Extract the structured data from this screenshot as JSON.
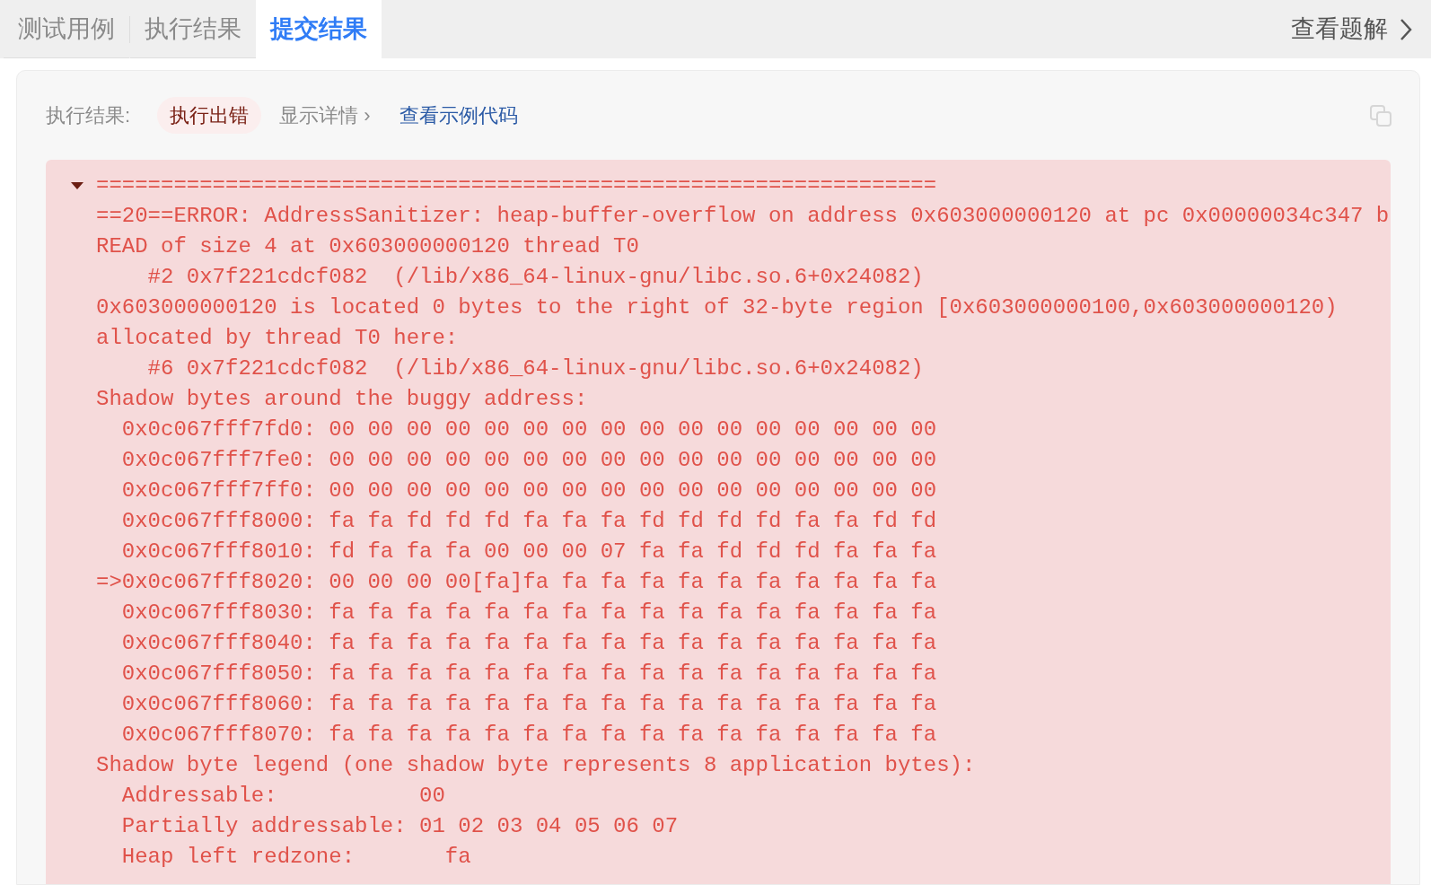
{
  "tabs": [
    {
      "label": "测试用例",
      "selected": false
    },
    {
      "label": "执行结果",
      "selected": false
    },
    {
      "label": "提交结果",
      "selected": true
    }
  ],
  "solution_link": {
    "label": "查看题解"
  },
  "result": {
    "label": "执行结果:",
    "status": "执行出错",
    "details_toggle": "显示详情 ›",
    "example_link": "查看示例代码"
  },
  "output": {
    "expanded": true,
    "lines": [
      "=================================================================",
      "==20==ERROR: AddressSanitizer: heap-buffer-overflow on address 0x603000000120 at pc 0x00000034c347 b",
      "READ of size 4 at 0x603000000120 thread T0",
      "    #2 0x7f221cdcf082  (/lib/x86_64-linux-gnu/libc.so.6+0x24082)",
      "0x603000000120 is located 0 bytes to the right of 32-byte region [0x603000000100,0x603000000120)",
      "allocated by thread T0 here:",
      "    #6 0x7f221cdcf082  (/lib/x86_64-linux-gnu/libc.so.6+0x24082)",
      "Shadow bytes around the buggy address:",
      "  0x0c067fff7fd0: 00 00 00 00 00 00 00 00 00 00 00 00 00 00 00 00",
      "  0x0c067fff7fe0: 00 00 00 00 00 00 00 00 00 00 00 00 00 00 00 00",
      "  0x0c067fff7ff0: 00 00 00 00 00 00 00 00 00 00 00 00 00 00 00 00",
      "  0x0c067fff8000: fa fa fd fd fd fa fa fa fd fd fd fd fa fa fd fd",
      "  0x0c067fff8010: fd fa fa fa 00 00 00 07 fa fa fd fd fd fa fa fa",
      "=>0x0c067fff8020: 00 00 00 00[fa]fa fa fa fa fa fa fa fa fa fa fa",
      "  0x0c067fff8030: fa fa fa fa fa fa fa fa fa fa fa fa fa fa fa fa",
      "  0x0c067fff8040: fa fa fa fa fa fa fa fa fa fa fa fa fa fa fa fa",
      "  0x0c067fff8050: fa fa fa fa fa fa fa fa fa fa fa fa fa fa fa fa",
      "  0x0c067fff8060: fa fa fa fa fa fa fa fa fa fa fa fa fa fa fa fa",
      "  0x0c067fff8070: fa fa fa fa fa fa fa fa fa fa fa fa fa fa fa fa",
      "Shadow byte legend (one shadow byte represents 8 application bytes):",
      "  Addressable:           00",
      "  Partially addressable: 01 02 03 04 05 06 07",
      "  Heap left redzone:       fa"
    ]
  }
}
